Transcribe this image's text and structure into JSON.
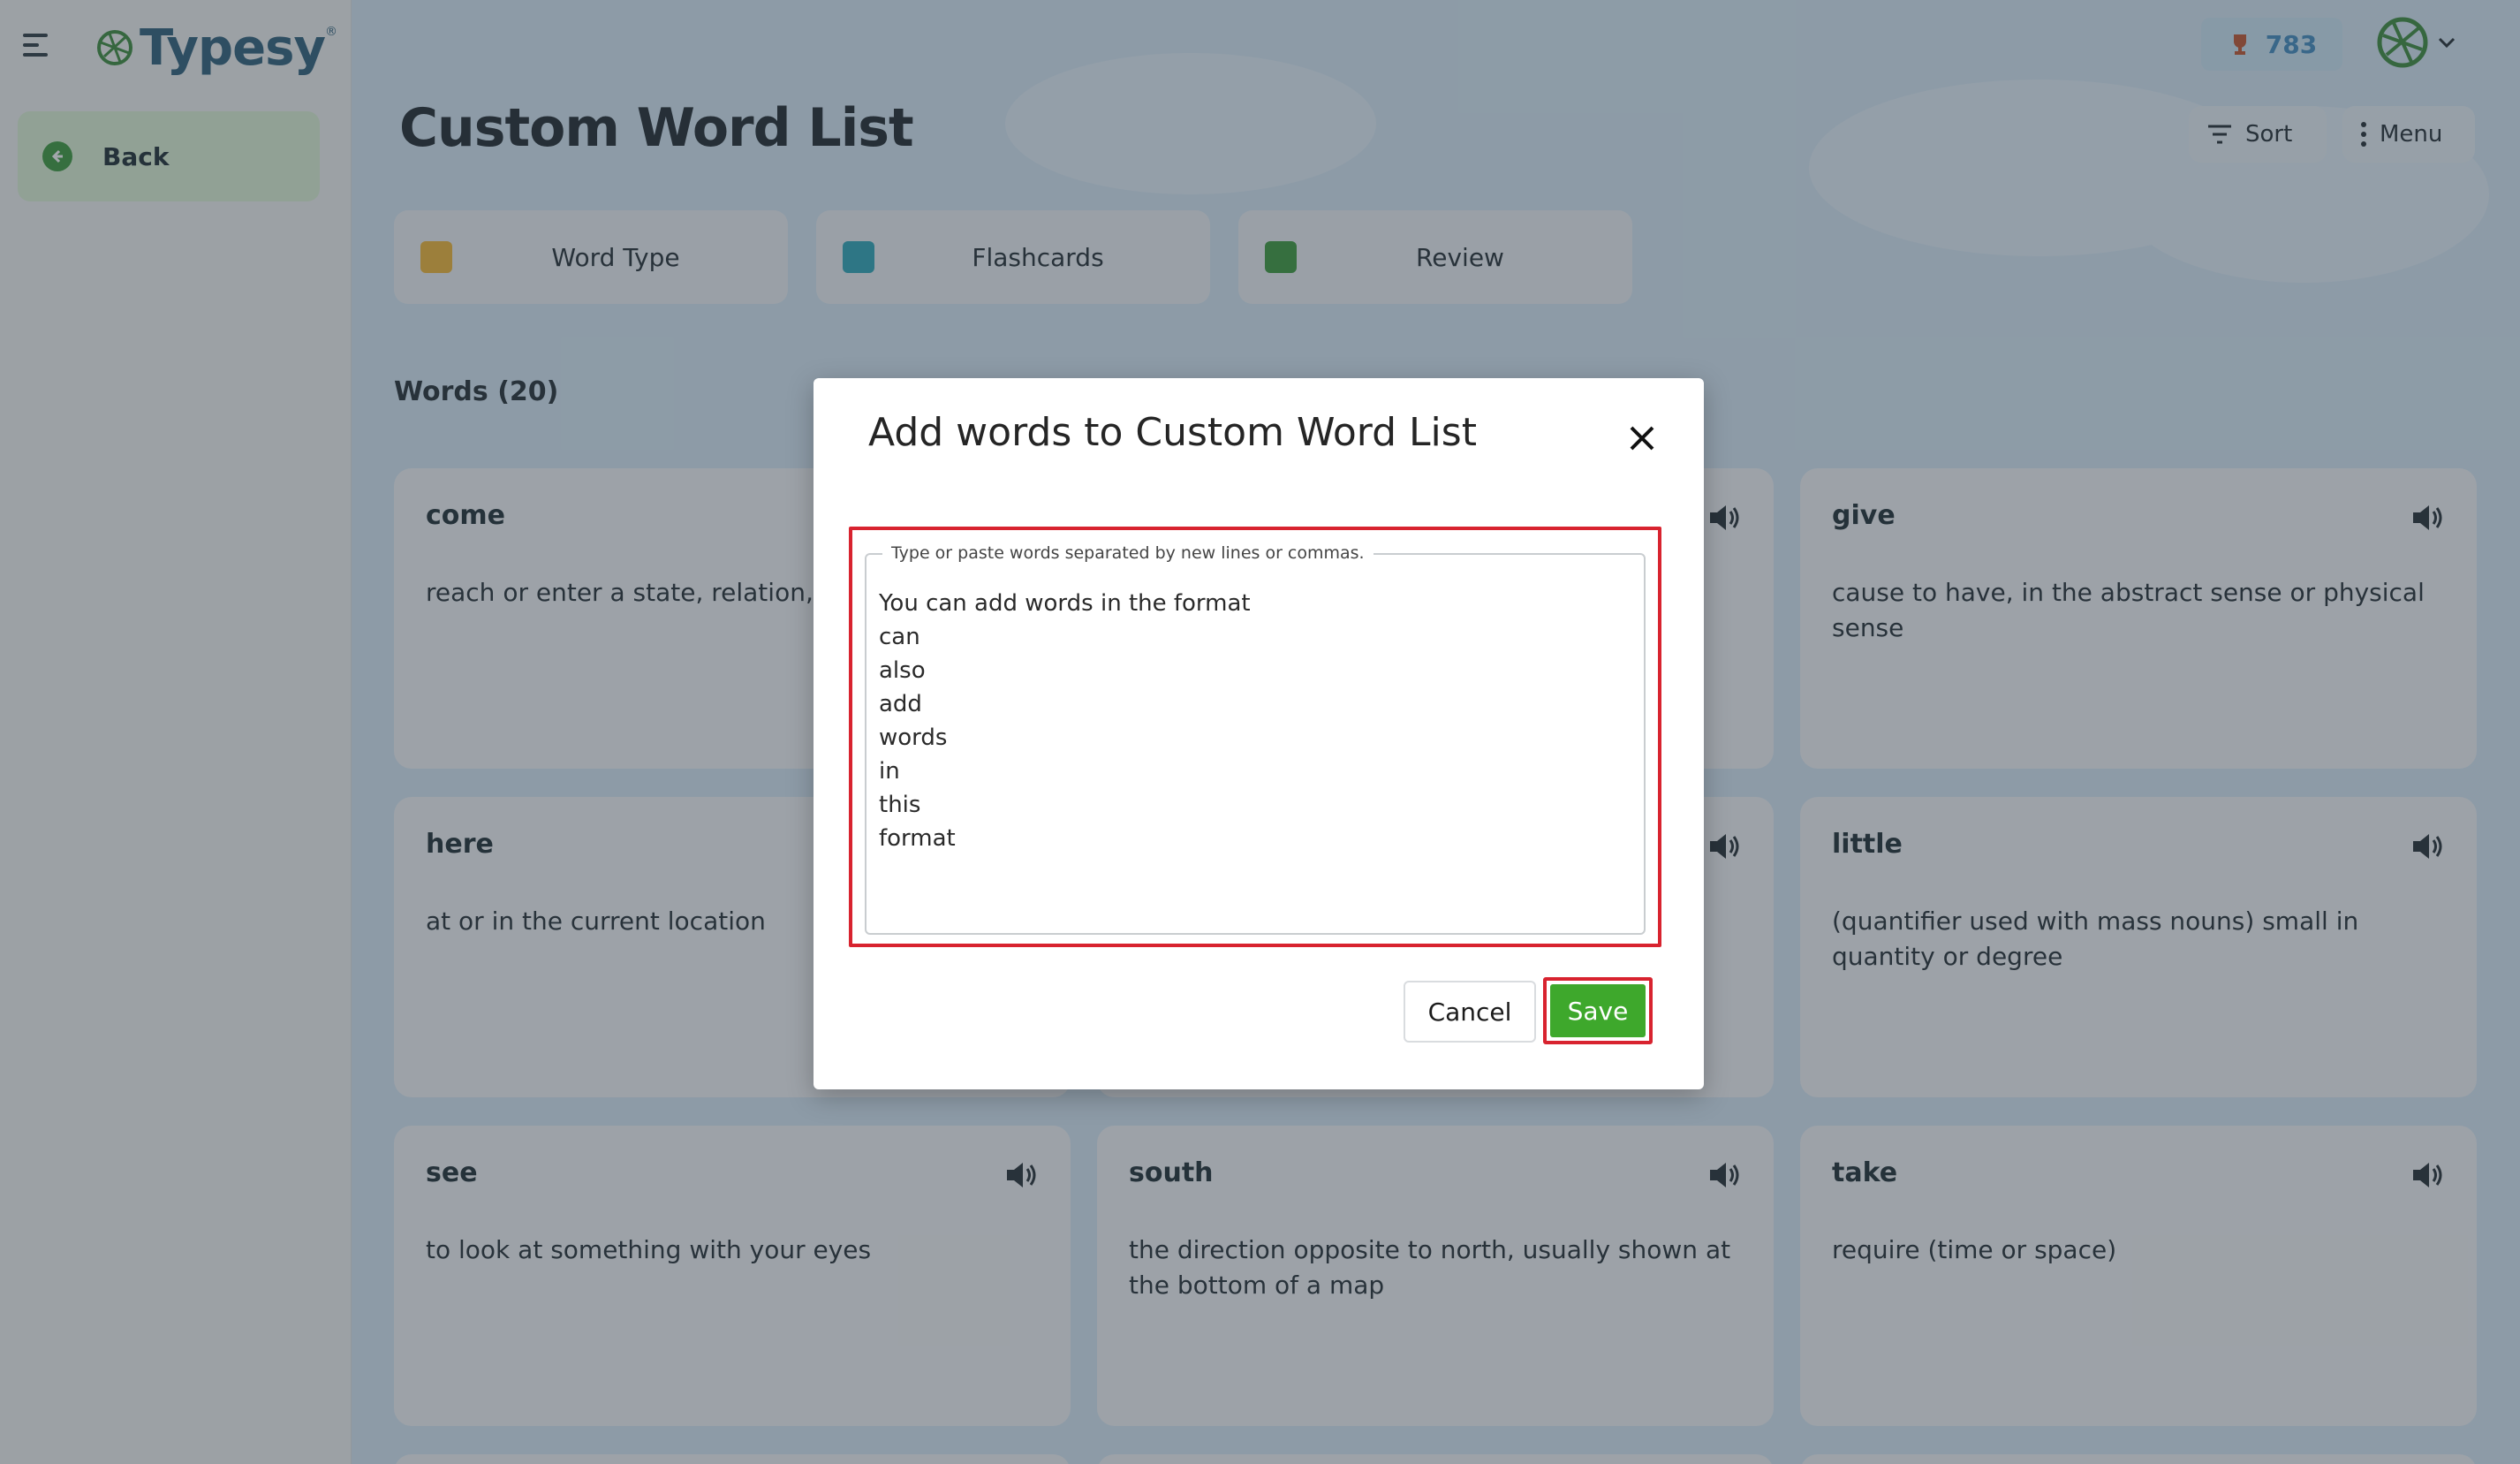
{
  "app": {
    "logo_text": "Typesy",
    "logo_reg": "®",
    "back_label": "Back",
    "score": "783",
    "page_title": "Custom Word List",
    "sort_label": "Sort",
    "menu_label": "Menu"
  },
  "tiles": [
    {
      "label": "Word Type",
      "icon_color": "#f2b632",
      "icon": "book-icon"
    },
    {
      "label": "Flashcards",
      "icon_color": "#2aa6b8",
      "icon": "flashcards-icon"
    },
    {
      "label": "Review",
      "icon_color": "#3a9a3a",
      "icon": "review-icon"
    }
  ],
  "words_heading": "Words (20)",
  "cards": [
    {
      "word": "come",
      "definition": "reach or enter a state, relation, c position"
    },
    {
      "word": "",
      "definition": ""
    },
    {
      "word": "give",
      "definition": "cause to have, in the abstract sense or physical sense"
    },
    {
      "word": "here",
      "definition": "at or in the current location"
    },
    {
      "word": "",
      "definition": ""
    },
    {
      "word": "little",
      "definition": "(quantifier used with mass nouns) small in quantity or degree"
    },
    {
      "word": "see",
      "definition": "to look at something with your eyes"
    },
    {
      "word": "south",
      "definition": "the direction opposite to north, usually shown at the bottom of a map"
    },
    {
      "word": "take",
      "definition": "require (time or space)"
    }
  ],
  "modal": {
    "title": "Add words to Custom Word List",
    "field_legend": "Type or paste words separated by new lines or commas.",
    "textarea_lines": [
      "You can add words in the format",
      "can",
      "also",
      "add",
      "words",
      "in",
      "this",
      "format"
    ],
    "cancel_label": "Cancel",
    "save_label": "Save"
  },
  "colors": {
    "accent_green": "#3ea82c",
    "highlight_red": "#d8232f",
    "brand_blue": "#2a5d78"
  }
}
